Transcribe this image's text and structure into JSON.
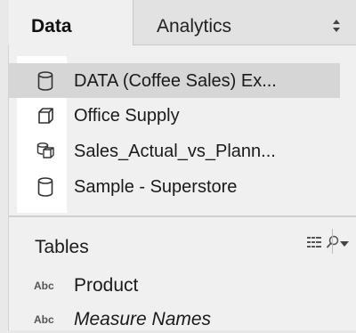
{
  "tabs": {
    "data_label": "Data",
    "analytics_label": "Analytics"
  },
  "data_sources": [
    {
      "name": "DATA (Coffee Sales) Ex...",
      "icon": "database-cylinder-icon",
      "selected": true
    },
    {
      "name": "Office Supply",
      "icon": "cube-icon",
      "selected": false
    },
    {
      "name": "Sales_Actual_vs_Plann...",
      "icon": "federated-source-icon",
      "selected": false
    },
    {
      "name": "Sample - Superstore",
      "icon": "database-cylinder-icon",
      "selected": false
    }
  ],
  "tables": {
    "title": "Tables",
    "fields": [
      {
        "type_badge": "Abc",
        "name": "Product",
        "italic": false
      },
      {
        "type_badge": "Abc",
        "name": "Measure Names",
        "italic": true
      }
    ]
  },
  "colors": {
    "panel_bg": "#f0f0f0",
    "selected_row": "#d6d6d6",
    "highlight": "#ffffff"
  }
}
